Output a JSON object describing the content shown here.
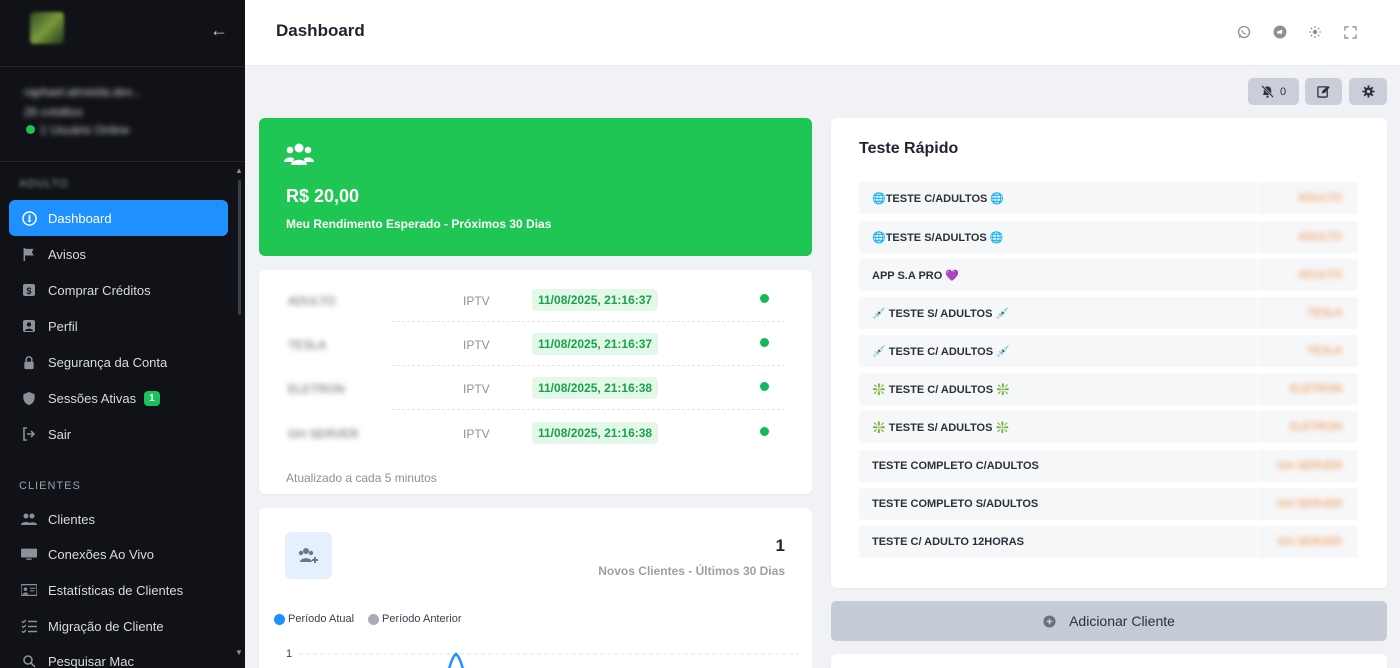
{
  "sidebar": {
    "user_name": "raphael.almeida.dev...",
    "user_role": "26 créditos",
    "user_status": "1 Usuário Online",
    "section_adulto": "ADULTO",
    "section_clientes": "CLIENTES",
    "items": [
      {
        "label": "Dashboard",
        "icon": "dashboard-icon",
        "active": true
      },
      {
        "label": "Avisos",
        "icon": "flag-icon"
      },
      {
        "label": "Comprar Créditos",
        "icon": "dollar-icon"
      },
      {
        "label": "Perfil",
        "icon": "user-icon"
      },
      {
        "label": "Segurança da Conta",
        "icon": "lock-icon"
      },
      {
        "label": "Sessões Ativas",
        "icon": "shield-icon",
        "badge": "1"
      },
      {
        "label": "Sair",
        "icon": "logout-icon"
      }
    ],
    "clientes_items": [
      {
        "label": "Clientes",
        "icon": "users-icon"
      },
      {
        "label": "Conexões Ao Vivo",
        "icon": "monitor-icon"
      },
      {
        "label": "Estatísticas de Clientes",
        "icon": "stats-icon"
      },
      {
        "label": "Migração de Cliente",
        "icon": "list-icon"
      },
      {
        "label": "Pesquisar Mac",
        "icon": "search-icon"
      }
    ]
  },
  "header": {
    "title": "Dashboard"
  },
  "actions": {
    "notifications_count": "0"
  },
  "revenue": {
    "amount": "R$ 20,00",
    "label": "Meu Rendimento Esperado - Próximos 30 Dias"
  },
  "servers": {
    "rows": [
      {
        "name": "ADULTO",
        "type": "IPTV",
        "date": "11/08/2025, 21:16:37"
      },
      {
        "name": "TESLA",
        "type": "IPTV",
        "date": "11/08/2025, 21:16:37"
      },
      {
        "name": "ELETRON",
        "type": "IPTV",
        "date": "11/08/2025, 21:16:38"
      },
      {
        "name": "GH SERVER",
        "type": "IPTV",
        "date": "11/08/2025, 21:16:38"
      }
    ],
    "footer": "Atualizado a cada 5 minutos"
  },
  "new_clients": {
    "value": "1",
    "label": "Novos Clientes - Últimos 30 Dias",
    "legend_current": "Período Atual",
    "legend_previous": "Período Anterior",
    "y_tick": "1"
  },
  "quick_test": {
    "title": "Teste Rápido",
    "rows": [
      {
        "name": "🌐TESTE C/ADULTOS 🌐",
        "server": "ADULTO"
      },
      {
        "name": "🌐TESTE S/ADULTOS 🌐",
        "server": "ADULTO"
      },
      {
        "name": "APP S.A PRO 💜",
        "server": "ADULTO"
      },
      {
        "name": "💉 TESTE S/ ADULTOS 💉",
        "server": "TESLA"
      },
      {
        "name": "💉 TESTE C/ ADULTOS 💉",
        "server": "TESLA"
      },
      {
        "name": "❇️ TESTE C/ ADULTOS ❇️",
        "server": "ELETRON"
      },
      {
        "name": "❇️ TESTE S/ ADULTOS ❇️",
        "server": "ELETRON"
      },
      {
        "name": "TESTE COMPLETO C/ADULTOS",
        "server": "GH SERVER"
      },
      {
        "name": "TESTE COMPLETO S/ADULTOS",
        "server": "GH SERVER"
      },
      {
        "name": "TESTE C/ ADULTO 12HORAS",
        "server": "GH SERVER"
      }
    ]
  },
  "add_client": {
    "label": "Adicionar Cliente"
  },
  "colors": {
    "accent": "#1e90ff",
    "success": "#1fc653",
    "sidebar": "#101217",
    "badge": "#18c45a"
  }
}
